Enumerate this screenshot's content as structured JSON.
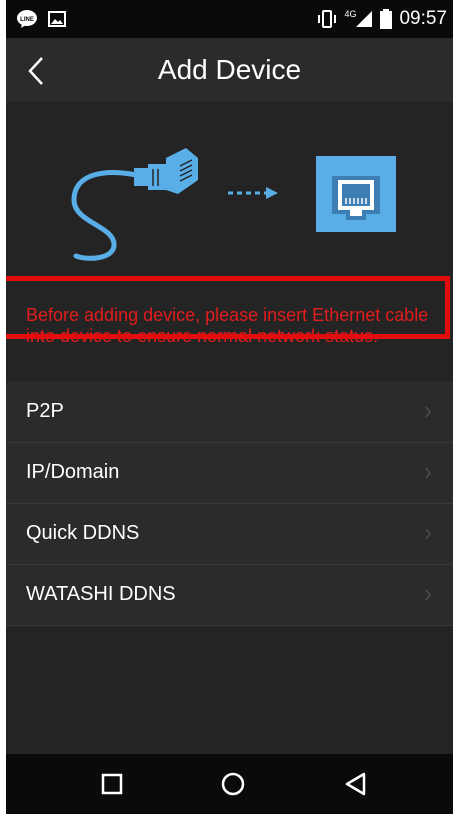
{
  "status_bar": {
    "network_label": "4G",
    "time": "09:57",
    "icons": [
      "line-app-icon",
      "image-notification-icon",
      "vibrate-icon",
      "signal-icon",
      "battery-icon"
    ]
  },
  "header": {
    "title": "Add Device",
    "back_icon": "chevron-left-icon"
  },
  "illustration": {
    "description_icons": [
      "ethernet-cable-icon",
      "dashed-arrow-icon",
      "ethernet-port-icon"
    ],
    "accent_color": "#5aaee8"
  },
  "warning": {
    "text": "Before adding device, please insert Ethernet cable into device to ensure normal network status.",
    "color": "#e21c1c"
  },
  "menu": {
    "items": [
      {
        "label": "P2P"
      },
      {
        "label": "IP/Domain"
      },
      {
        "label": "Quick DDNS"
      },
      {
        "label": "WATASHI DDNS"
      }
    ]
  },
  "highlight": {
    "color": "#e30d10",
    "target": "P2P"
  },
  "nav_bar": {
    "icons": [
      "recent-apps-icon",
      "home-icon",
      "back-icon"
    ]
  }
}
